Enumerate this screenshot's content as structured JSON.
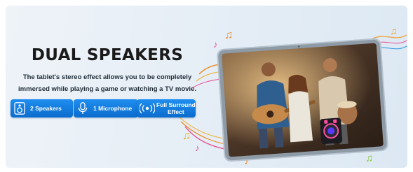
{
  "banner": {
    "headline": "DUAL SPEAKERS",
    "description_line1": "The tablet's stereo effect allows you to be completely",
    "description_line2": "immersed while  playing a game or watching a TV movie."
  },
  "features": [
    {
      "label": "2 Speakers",
      "icon": "speaker-icon"
    },
    {
      "label": "1 Microphone",
      "icon": "microphone-icon"
    },
    {
      "label_line1": "Full Surround",
      "label_line2": "Effect",
      "icon": "surround-sound-icon"
    }
  ],
  "colors": {
    "accent_blue": "#0a6ccd",
    "background": "#e6eef6",
    "tablet_frame": "#b7c3cf"
  },
  "decorations": [
    "music-notes",
    "star-icon",
    "tablet-photo"
  ]
}
